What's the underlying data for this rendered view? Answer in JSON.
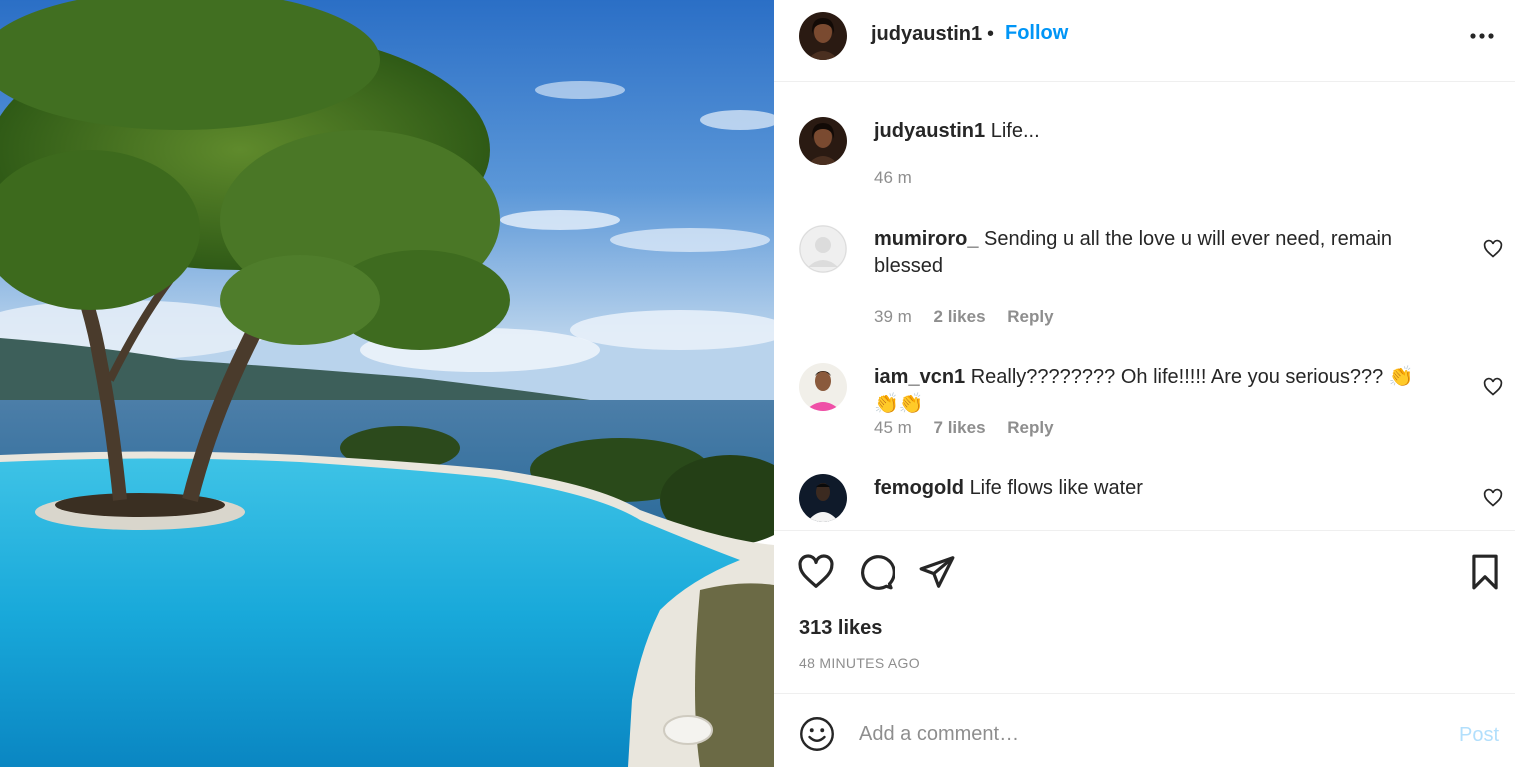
{
  "post": {
    "username": "judyaustin1",
    "follow_label": "Follow",
    "separator": "•",
    "likes": "313 likes",
    "posted_time": "48 MINUTES AGO"
  },
  "caption": {
    "username": "judyaustin1",
    "text": "Life...",
    "time": "46 m"
  },
  "comments": [
    {
      "username": "mumiroro_",
      "text": "Sending u all the love u will ever need, remain blessed",
      "time": "39 m",
      "likes": "2 likes",
      "reply": "Reply"
    },
    {
      "username": "iam_vcn1",
      "text": "Really???????? Oh life!!!!! Are you serious??? 👏👏👏",
      "time": "45 m",
      "likes": "7 likes",
      "reply": "Reply"
    },
    {
      "username": "femogold",
      "text": "Life flows like water",
      "time": "",
      "likes": "",
      "reply": ""
    }
  ],
  "comment_box": {
    "placeholder": "Add a comment…",
    "post_label": "Post"
  },
  "icons": {
    "like": "heart-icon",
    "comment": "speech-bubble-icon",
    "share": "paper-plane-icon",
    "save": "bookmark-icon",
    "more": "more-horizontal-icon",
    "emoji": "smiley-icon"
  },
  "colors": {
    "accent": "#0095f6",
    "post_disabled": "#b2dffc",
    "muted": "#8e8e8e"
  }
}
